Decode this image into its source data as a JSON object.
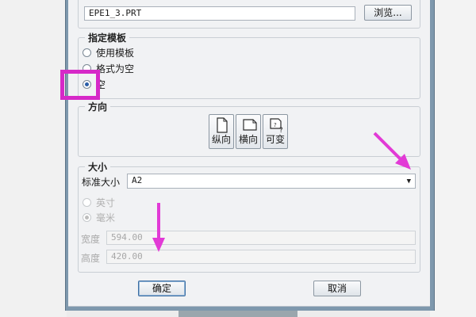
{
  "file": {
    "name_value": "EPE1_3.PRT",
    "browse_label": "浏览..."
  },
  "template": {
    "legend": "指定模板",
    "options": [
      {
        "label": "使用模板",
        "selected": false
      },
      {
        "label": "格式为空",
        "selected": false
      },
      {
        "label": "空",
        "selected": true
      }
    ]
  },
  "orientation": {
    "legend": "方向",
    "buttons": [
      {
        "label": "纵向",
        "icon": "portrait-page-icon"
      },
      {
        "label": "横向",
        "icon": "landscape-page-icon"
      },
      {
        "label": "可变",
        "icon": "variable-page-icon"
      }
    ]
  },
  "size": {
    "legend": "大小",
    "standard_label": "标准大小",
    "standard_value": "A2",
    "units": [
      {
        "label": "英寸",
        "selected": false
      },
      {
        "label": "毫米",
        "selected": true
      }
    ],
    "width_label": "宽度",
    "width_value": "594.00",
    "height_label": "高度",
    "height_value": "420.00"
  },
  "buttons": {
    "ok": "确定",
    "cancel": "取消"
  },
  "colors": {
    "highlight": "#d629c8",
    "arrow": "#e23ad6",
    "window_frame": "#7e98ad"
  }
}
